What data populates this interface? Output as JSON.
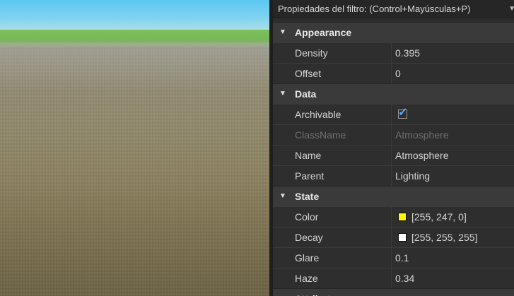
{
  "filter": {
    "label": "Propiedades del filtro: (Control+Mayúsculas+P)"
  },
  "colors": {
    "color_swatch": "#fff700",
    "decay_swatch": "#ffffff"
  },
  "sections": {
    "appearance": {
      "label": "Appearance",
      "density": {
        "name": "Density",
        "value": "0.395"
      },
      "offset": {
        "name": "Offset",
        "value": "0"
      }
    },
    "data": {
      "label": "Data",
      "archivable": {
        "name": "Archivable",
        "checked": true
      },
      "classname": {
        "name": "ClassName",
        "value": "Atmosphere"
      },
      "name": {
        "name": "Name",
        "value": "Atmosphere"
      },
      "parent": {
        "name": "Parent",
        "value": "Lighting"
      }
    },
    "state": {
      "label": "State",
      "color": {
        "name": "Color",
        "value": "[255, 247, 0]"
      },
      "decay": {
        "name": "Decay",
        "value": "[255, 255, 255]"
      },
      "glare": {
        "name": "Glare",
        "value": "0.1"
      },
      "haze": {
        "name": "Haze",
        "value": "0.34"
      }
    },
    "attributes": {
      "label": "Attributes"
    }
  }
}
